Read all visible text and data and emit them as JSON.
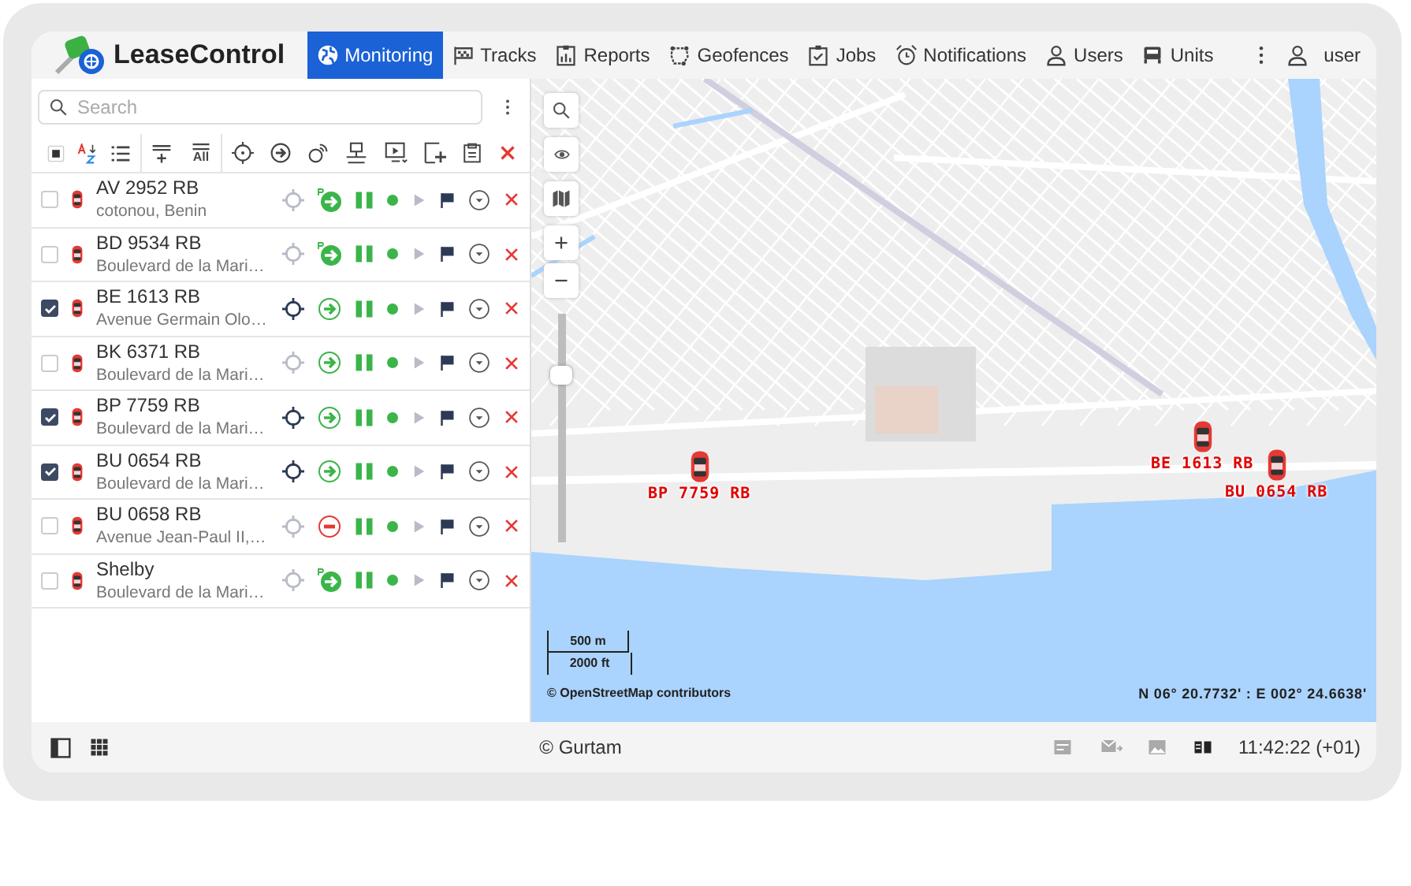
{
  "header": {
    "logo": "LeaseControl",
    "nav": [
      {
        "label": "Monitoring",
        "kind": "globe",
        "selected": true
      },
      {
        "label": "Tracks",
        "kind": "track",
        "selected": false
      },
      {
        "label": "Reports",
        "kind": "report",
        "selected": false
      },
      {
        "label": "Geofences",
        "kind": "geofence",
        "selected": false
      },
      {
        "label": "Jobs",
        "kind": "job",
        "selected": false
      },
      {
        "label": "Notifications",
        "kind": "alarm",
        "selected": false
      },
      {
        "label": "Users",
        "kind": "person",
        "selected": false
      },
      {
        "label": "Units",
        "kind": "bus",
        "selected": false
      }
    ],
    "user": "user"
  },
  "panel": {
    "search": {
      "placeholder": "Search"
    },
    "toolbar": {
      "all_label": "All",
      "select_all_partial": true
    },
    "units": [
      {
        "name": "AV 2952 RB",
        "address": "cotonou, Benin",
        "checked": false,
        "kind": "parked"
      },
      {
        "name": "BD 9534 RB",
        "address": "Boulevard de la Mari…",
        "checked": false,
        "kind": "parked"
      },
      {
        "name": "BE 1613 RB",
        "address": "Avenue Germain Olo…",
        "checked": true,
        "kind": "moving"
      },
      {
        "name": "BK 6371 RB",
        "address": "Boulevard de la Mari…",
        "checked": false,
        "kind": "moving"
      },
      {
        "name": "BP 7759 RB",
        "address": "Boulevard de la Mari…",
        "checked": true,
        "kind": "moving"
      },
      {
        "name": "BU 0654 RB",
        "address": "Boulevard de la Mari…",
        "checked": true,
        "kind": "moving"
      },
      {
        "name": "BU 0658 RB",
        "address": "Avenue Jean-Paul II,…",
        "checked": false,
        "kind": "stopped"
      },
      {
        "name": "Shelby",
        "address": "Boulevard de la Mari…",
        "checked": false,
        "kind": "parked"
      }
    ]
  },
  "map": {
    "zoom": {
      "level": 0.75
    },
    "markers": [
      {
        "label": "BE 1613 RB"
      },
      {
        "label": "BU 0654 RB"
      },
      {
        "label": "BP 7759 RB"
      }
    ],
    "scale": [
      "500 m",
      "2000 ft"
    ],
    "attribution": "© OpenStreetMap contributors",
    "coordinates": "N 06° 20.7732' : E 002° 24.6638'"
  },
  "status_bar": {
    "copyright": "© Gurtam",
    "time": "11:42:22 (+01)"
  }
}
